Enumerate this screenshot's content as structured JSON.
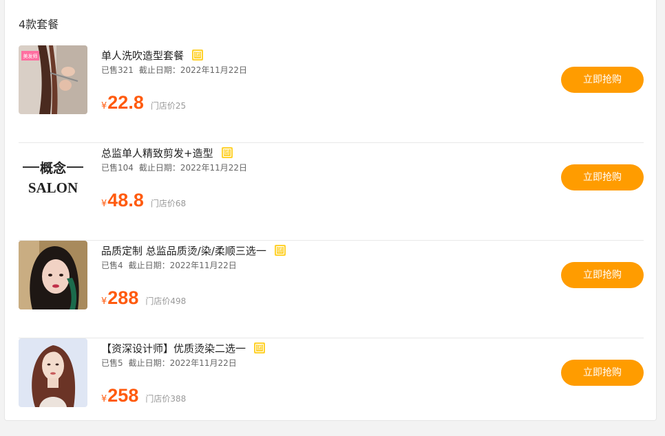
{
  "header": {
    "title": "4款套餐"
  },
  "items": [
    {
      "name": "单人洗吹造型套餐",
      "tag": "团",
      "sold": "已售321",
      "deadline": "截止日期：2022年11月22日",
      "currency": "¥",
      "price": "22.8",
      "store_price": "门店价25",
      "button": "立即抢购",
      "image_badge": "美发师"
    },
    {
      "name": "总监单人精致剪发+造型",
      "tag": "团",
      "sold": "已售104",
      "deadline": "截止日期：2022年11月22日",
      "currency": "¥",
      "price": "48.8",
      "store_price": "门店价68",
      "button": "立即抢购",
      "logo_top": "概念",
      "logo_bottom": "SALON"
    },
    {
      "name": "品质定制 总监品质烫/染/柔顺三选一",
      "tag": "团",
      "sold": "已售4",
      "deadline": "截止日期：2022年11月22日",
      "currency": "¥",
      "price": "288",
      "store_price": "门店价498",
      "button": "立即抢购"
    },
    {
      "name": "【资深设计师】优质烫染二选一",
      "tag": "团",
      "sold": "已售5",
      "deadline": "截止日期：2022年11月22日",
      "currency": "¥",
      "price": "258",
      "store_price": "门店价388",
      "button": "立即抢购"
    }
  ],
  "colors": {
    "accent_button": "#ff9c00",
    "price": "#ff5b0f",
    "tag": "#ffd22e"
  }
}
